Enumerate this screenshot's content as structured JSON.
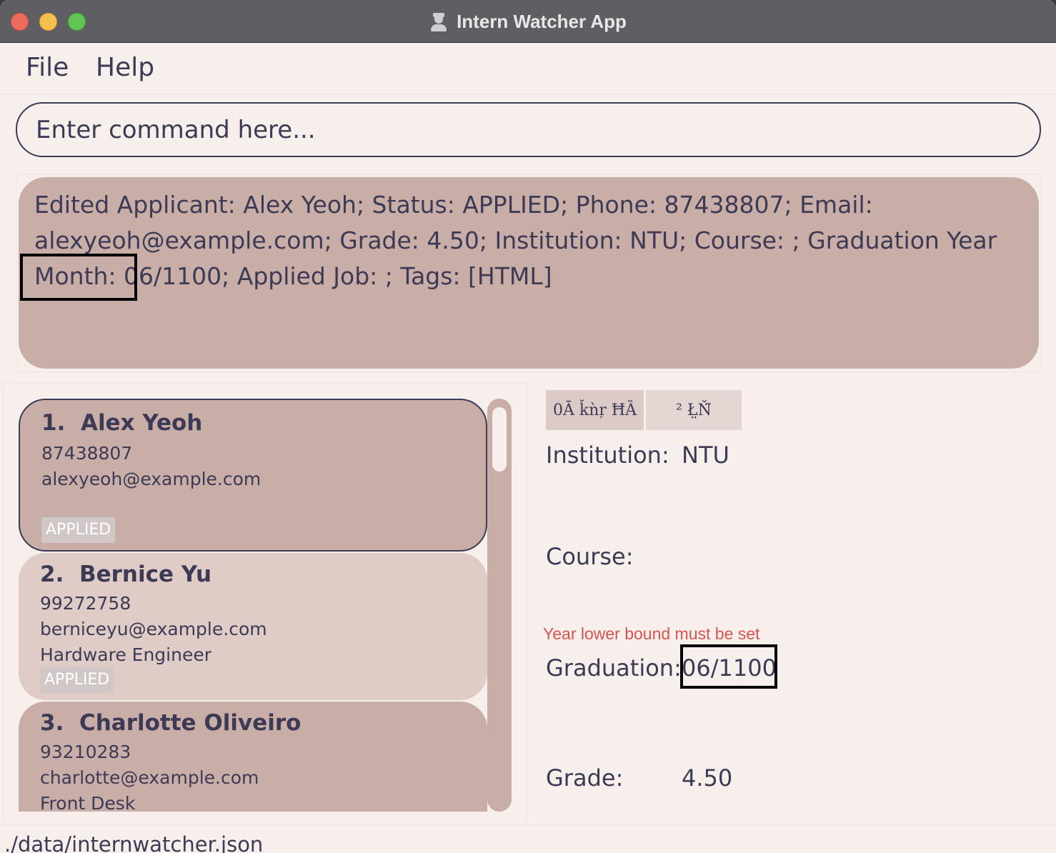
{
  "window": {
    "title": "Intern Watcher App"
  },
  "menu": {
    "file": "File",
    "help": "Help"
  },
  "command": {
    "placeholder": "Enter command here...",
    "value": ""
  },
  "result": {
    "message": "Edited Applicant: Alex Yeoh; Status: APPLIED; Phone: 87438807; Email: alexyeoh@example.com; Grade: 4.50; Institution: NTU; Course: ; Graduation Year Month: 06/1100; Applied Job: ; Tags: [HTML]"
  },
  "applicants": [
    {
      "index": "1.",
      "name": "Alex Yeoh",
      "phone": "87438807",
      "email": "alexyeoh@example.com",
      "job": "",
      "status": "APPLIED"
    },
    {
      "index": "2.",
      "name": "Bernice Yu",
      "phone": "99272758",
      "email": "berniceyu@example.com",
      "job": "Hardware Engineer",
      "status": "APPLIED"
    },
    {
      "index": "3.",
      "name": "Charlotte Oliveiro",
      "phone": "93210283",
      "email": "charlotte@example.com",
      "job": "Front Desk",
      "status": ""
    }
  ],
  "detail": {
    "tabs": [
      "0Ā ǩǹŗ ĦȀ",
      "² Ł̤Ň̈"
    ],
    "institution_label": "Institution:",
    "institution_value": "NTU",
    "course_label": "Course:",
    "course_value": "",
    "error": "Year lower bound must be set",
    "graduation_label": "Graduation:",
    "graduation_value": "06/1100",
    "grade_label": "Grade:",
    "grade_value": "4.50"
  },
  "status_bar": {
    "path": "./data/internwatcher.json"
  },
  "colors": {
    "accent_dark": "#3c3a55",
    "card": "#c9aea8",
    "card_alt": "#e0ccc7",
    "background": "#f7efeb",
    "error": "#d9534f"
  }
}
